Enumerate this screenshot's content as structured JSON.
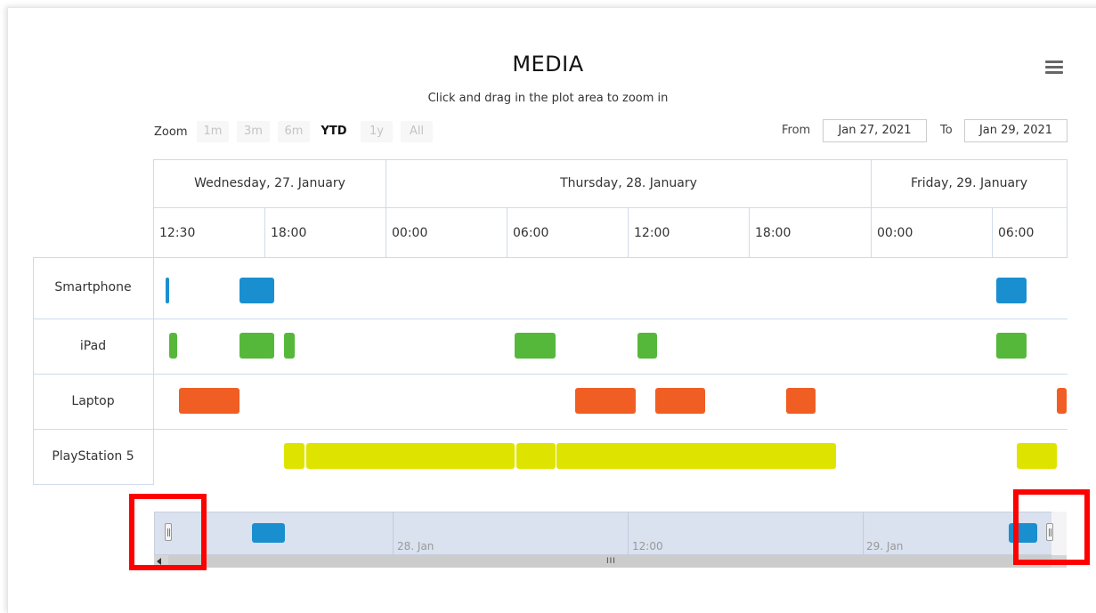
{
  "chart_data": {
    "type": "gantt",
    "title": "MEDIA",
    "subtitle": "Click and drag in the plot area to zoom in",
    "x_range": [
      "2021-01-27 12:00",
      "2021-01-29 09:30"
    ],
    "day_headers": [
      "Wednesday, 27. January",
      "Thursday, 28. January",
      "Friday, 29. January"
    ],
    "hour_ticks": [
      "12:30",
      "18:00",
      "00:00",
      "06:00",
      "12:00",
      "18:00",
      "00:00",
      "06:00"
    ],
    "categories": [
      "Smartphone",
      "iPad",
      "Laptop",
      "PlayStation 5"
    ],
    "colors": [
      "#1a8fd0",
      "#56b83b",
      "#f05e23",
      "#dfe300"
    ],
    "tasks": [
      {
        "category": "Smartphone",
        "start": "2021-01-27 12:35",
        "end": "2021-01-27 12:40"
      },
      {
        "category": "Smartphone",
        "start": "2021-01-27 16:15",
        "end": "2021-01-27 18:00"
      },
      {
        "category": "Smartphone",
        "start": "2021-01-29 06:00",
        "end": "2021-01-29 07:30"
      },
      {
        "category": "iPad",
        "start": "2021-01-27 12:45",
        "end": "2021-01-27 13:10"
      },
      {
        "category": "iPad",
        "start": "2021-01-27 16:15",
        "end": "2021-01-27 18:00"
      },
      {
        "category": "iPad",
        "start": "2021-01-27 18:30",
        "end": "2021-01-27 19:00"
      },
      {
        "category": "iPad",
        "start": "2021-01-28 06:00",
        "end": "2021-01-28 08:00"
      },
      {
        "category": "iPad",
        "start": "2021-01-28 12:05",
        "end": "2021-01-28 13:05"
      },
      {
        "category": "iPad",
        "start": "2021-01-29 06:00",
        "end": "2021-01-29 07:30"
      },
      {
        "category": "Laptop",
        "start": "2021-01-27 13:15",
        "end": "2021-01-27 16:15"
      },
      {
        "category": "Laptop",
        "start": "2021-01-28 09:00",
        "end": "2021-01-28 12:00"
      },
      {
        "category": "Laptop",
        "start": "2021-01-28 13:00",
        "end": "2021-01-28 15:30"
      },
      {
        "category": "Laptop",
        "start": "2021-01-28 19:30",
        "end": "2021-01-28 21:00"
      },
      {
        "category": "Laptop",
        "start": "2021-01-29 09:00",
        "end": "2021-01-29 09:30"
      },
      {
        "category": "PlayStation 5",
        "start": "2021-01-27 18:30",
        "end": "2021-01-27 19:30"
      },
      {
        "category": "PlayStation 5",
        "start": "2021-01-27 19:35",
        "end": "2021-01-28 06:00"
      },
      {
        "category": "PlayStation 5",
        "start": "2021-01-28 06:05",
        "end": "2021-01-28 08:00"
      },
      {
        "category": "PlayStation 5",
        "start": "2021-01-28 08:05",
        "end": "2021-01-28 22:00"
      },
      {
        "category": "PlayStation 5",
        "start": "2021-01-29 07:00",
        "end": "2021-01-29 09:00"
      }
    ],
    "navigator": {
      "labels": [
        "28. Jan",
        "12:00",
        "29. Jan"
      ],
      "series_color": "#1a8fd0"
    }
  },
  "menu_icon": "hamburger-menu-icon",
  "range_selector": {
    "zoom_label": "Zoom",
    "buttons": [
      "1m",
      "3m",
      "6m",
      "YTD",
      "1y",
      "All"
    ],
    "selected": "YTD",
    "from_label": "From",
    "from_value": "Jan 27, 2021",
    "to_label": "To",
    "to_value": "Jan 29, 2021"
  },
  "highlight_color": "#ff0000"
}
